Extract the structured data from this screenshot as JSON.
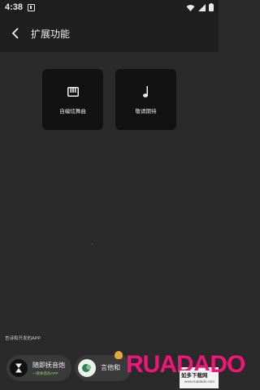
{
  "status_bar": {
    "time": "4:38",
    "icons": [
      "notification-icon",
      "wifi-icon",
      "signal-icon",
      "battery-icon"
    ]
  },
  "app_bar": {
    "back_icon": "chevron-left-icon",
    "title": "扩展功能"
  },
  "cards": [
    {
      "icon": "piano-icon",
      "label": "自编炫舞曲"
    },
    {
      "icon": "music-note-icon",
      "label": "敬请期待"
    }
  ],
  "footer_note": "言诗和开发的APP",
  "promos": [
    {
      "icon": "hourglass-icon",
      "title": "随即抚音炮",
      "subtitle": "一款休息的APP"
    },
    {
      "icon": "chat-icon",
      "title": "言他和",
      "subtitle": ""
    }
  ],
  "watermark": {
    "logo_text": "RUADADO",
    "subtitle": "如多下载网",
    "url": "www.ruadado.com"
  },
  "colors": {
    "background": "#2a2a2a",
    "app_bar": "#1f1f1f",
    "card": "#121212",
    "brand": "#f0157a"
  }
}
